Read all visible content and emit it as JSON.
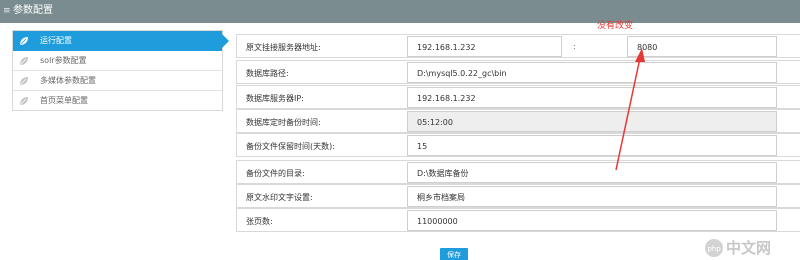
{
  "header": {
    "title": "参数配置",
    "menu_icon": "list-icon"
  },
  "sidebar": {
    "items": [
      {
        "label": "运行配置",
        "icon": "leaf-icon",
        "active": true
      },
      {
        "label": "solr参数配置",
        "icon": "leaf-icon",
        "active": false
      },
      {
        "label": "多媒体参数配置",
        "icon": "leaf-icon",
        "active": false
      },
      {
        "label": "首页菜单配置",
        "icon": "leaf-icon",
        "active": false
      }
    ]
  },
  "form": {
    "server": {
      "label": "原文挂接服务器地址:",
      "host": "192.168.1.232",
      "separator": ":",
      "port": "8080"
    },
    "db_path": {
      "label": "数据库路径:",
      "value": "D:\\mysql5.0.22_gc\\bin"
    },
    "db_ip": {
      "label": "数据库服务器IP:",
      "value": "192.168.1.232"
    },
    "backup_time": {
      "label": "数据库定时备份时间:",
      "value": "05:12:00"
    },
    "retention": {
      "label": "备份文件保留时间(天数):",
      "value": "15"
    },
    "backup_dir": {
      "label": "备份文件的目录:",
      "value": "D:\\数据库备份"
    },
    "watermark_text": {
      "label": "原文水印文字设置:",
      "value": "桐乡市档案局"
    },
    "pages": {
      "label": "张页数:",
      "value": "11000000"
    },
    "save_label": "保存"
  },
  "annotation": {
    "text": "没有改变",
    "color": "#e53935"
  },
  "watermark": {
    "text": "中文网"
  },
  "colors": {
    "accent": "#1e9cdb",
    "header_bg": "#7b8c90"
  }
}
